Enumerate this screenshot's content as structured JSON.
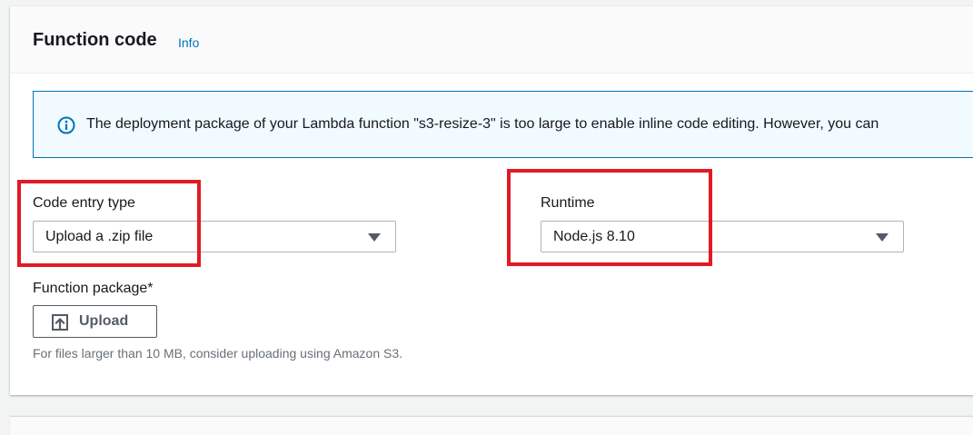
{
  "section": {
    "title": "Function code",
    "info_link": "Info"
  },
  "alert": {
    "icon": "info-circle-icon",
    "text": "The deployment package of your Lambda function \"s3-resize-3\" is too large to enable inline code editing. However, you can"
  },
  "code_entry": {
    "label": "Code entry type",
    "value": "Upload a .zip file"
  },
  "runtime": {
    "label": "Runtime",
    "value": "Node.js 8.10"
  },
  "function_package": {
    "label": "Function package*",
    "upload_icon": "upload-icon",
    "upload_label": "Upload",
    "hint": "For files larger than 10 MB, consider uploading using Amazon S3."
  },
  "colors": {
    "accent_link": "#0073bb",
    "highlight_box": "#e01b24",
    "alert_bg": "#f1faff"
  }
}
